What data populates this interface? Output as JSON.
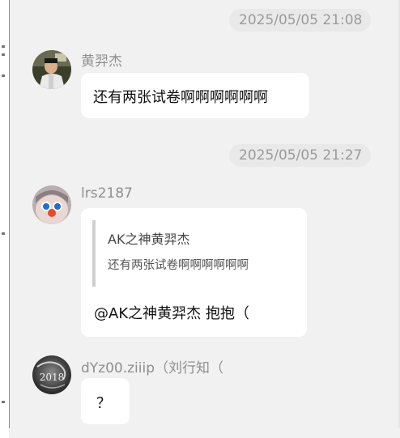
{
  "messages": [
    {
      "timestamp": "2025/05/05 21:08",
      "sender": "黄羿杰",
      "text": "还有两张试卷啊啊啊啊啊啊"
    },
    {
      "timestamp": "2025/05/05 21:27",
      "sender": "lrs2187",
      "quote": {
        "author": "AK之神黄羿杰",
        "text": "还有两张试卷啊啊啊啊啊啊"
      },
      "text": "@AK之神黄羿杰 抱抱（"
    },
    {
      "sender": "dYz00.ziiip（刘行知（",
      "avatar_text": "2018",
      "text": "？"
    }
  ]
}
